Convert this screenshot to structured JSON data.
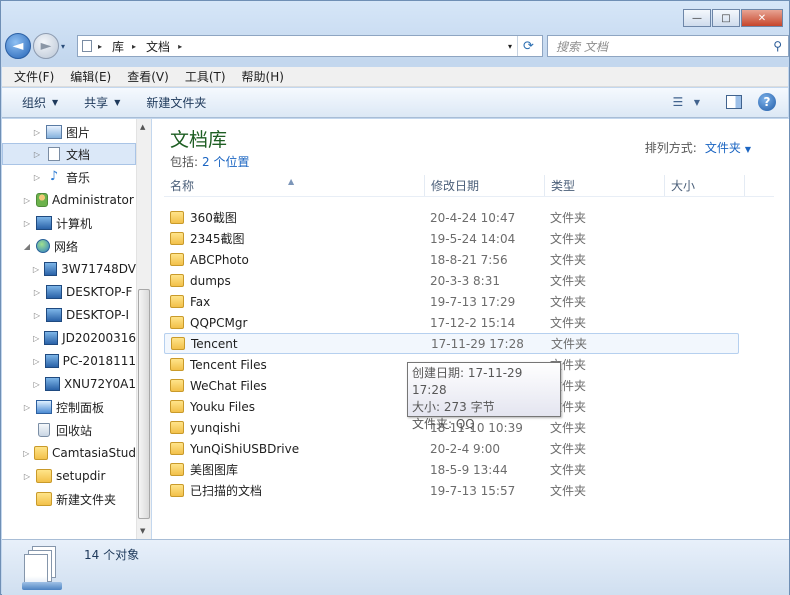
{
  "window": {
    "min_glyph": "—",
    "max_glyph": "□",
    "close_glyph": "✕"
  },
  "nav": {
    "back_glyph": "◄",
    "fwd_glyph": "►",
    "dropdown_glyph": "▾"
  },
  "address": {
    "crumbs": [
      "库",
      "文档"
    ],
    "separator": "▸"
  },
  "search": {
    "placeholder": "搜索 文档"
  },
  "menu": [
    "文件(F)",
    "编辑(E)",
    "查看(V)",
    "工具(T)",
    "帮助(H)"
  ],
  "toolbar": {
    "organize": "组织",
    "share": "共享",
    "new_folder": "新建文件夹",
    "help_glyph": "?"
  },
  "sidebar": {
    "items": [
      {
        "label": "图片",
        "icon": "pictures-icon"
      },
      {
        "label": "文档",
        "icon": "documents-icon"
      },
      {
        "label": "音乐",
        "icon": "music-icon"
      },
      {
        "label": "Administrator",
        "icon": "user-icon"
      },
      {
        "label": "计算机",
        "icon": "computer-icon"
      },
      {
        "label": "网络",
        "icon": "network-icon"
      },
      {
        "label": "3W71748DV",
        "icon": "computer-icon"
      },
      {
        "label": "DESKTOP-F",
        "icon": "computer-icon"
      },
      {
        "label": "DESKTOP-I",
        "icon": "computer-icon"
      },
      {
        "label": "JD20200316",
        "icon": "computer-icon"
      },
      {
        "label": "PC-2018111",
        "icon": "computer-icon"
      },
      {
        "label": "XNU72Y0A1",
        "icon": "computer-icon"
      },
      {
        "label": "控制面板",
        "icon": "control-panel-icon"
      },
      {
        "label": "回收站",
        "icon": "recycle-bin-icon"
      },
      {
        "label": "CamtasiaStud",
        "icon": "folder-icon"
      },
      {
        "label": "setupdir",
        "icon": "folder-icon"
      },
      {
        "label": "新建文件夹",
        "icon": "folder-icon"
      }
    ]
  },
  "library": {
    "title": "文档库",
    "includes_label": "包括:",
    "locations": "2 个位置",
    "arrange_label": "排列方式:",
    "arrange_value": "文件夹"
  },
  "columns": [
    "名称",
    "修改日期",
    "类型",
    "大小"
  ],
  "files": [
    {
      "name": "360截图",
      "date": "20-4-24 10:47",
      "type": "文件夹"
    },
    {
      "name": "2345截图",
      "date": "19-5-24 14:04",
      "type": "文件夹"
    },
    {
      "name": "ABCPhoto",
      "date": "18-8-21 7:56",
      "type": "文件夹"
    },
    {
      "name": "dumps",
      "date": "20-3-3 8:31",
      "type": "文件夹"
    },
    {
      "name": "Fax",
      "date": "19-7-13 17:29",
      "type": "文件夹"
    },
    {
      "name": "QQPCMgr",
      "date": "17-12-2 15:14",
      "type": "文件夹"
    },
    {
      "name": "Tencent",
      "date": "17-11-29 17:28",
      "type": "文件夹"
    },
    {
      "name": "Tencent Files",
      "date": "",
      "type": "文件夹"
    },
    {
      "name": "WeChat Files",
      "date": "",
      "type": "文件夹"
    },
    {
      "name": "Youku Files",
      "date": "",
      "type": "文件夹"
    },
    {
      "name": "yunqishi",
      "date": "18-11-10 10:39",
      "type": "文件夹"
    },
    {
      "name": "YunQiShiUSBDrive",
      "date": "20-2-4 9:00",
      "type": "文件夹"
    },
    {
      "name": "美图图库",
      "date": "18-5-9 13:44",
      "type": "文件夹"
    },
    {
      "name": "已扫描的文档",
      "date": "19-7-13 15:57",
      "type": "文件夹"
    }
  ],
  "tooltip": {
    "created": "创建日期: 17-11-29 17:28",
    "size": "大小: 273 字节",
    "folders": "文件夹: QQ"
  },
  "status": {
    "count": "14 个对象"
  }
}
